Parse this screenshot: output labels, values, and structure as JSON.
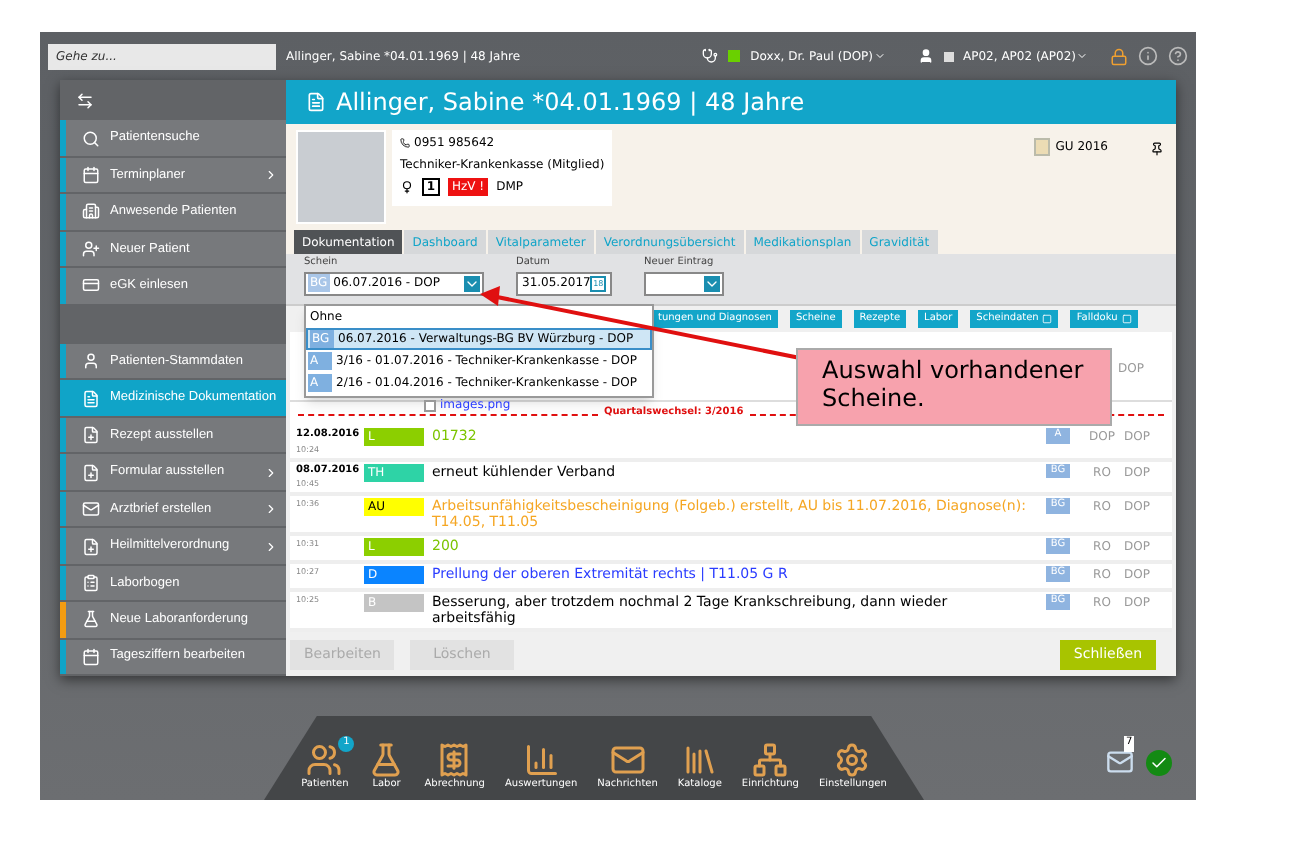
{
  "top_bar": {
    "goto_placeholder": "Gehe zu...",
    "patient": "Allinger, Sabine *04.01.1969 | 48 Jahre",
    "doctor": "Doxx, Dr. Paul (DOP)",
    "workstation": "AP02, AP02 (AP02)"
  },
  "sidebar": {
    "groups": [
      [
        {
          "label": "Patientensuche",
          "submenu": false,
          "selected": false,
          "color": "#10a4c8"
        },
        {
          "label": "Terminplaner",
          "submenu": true,
          "selected": false,
          "color": "#10a4c8"
        },
        {
          "label": "Anwesende Patienten",
          "submenu": false,
          "selected": false,
          "color": "#10a4c8"
        },
        {
          "label": "Neuer Patient",
          "submenu": false,
          "selected": false,
          "color": "#10a4c8"
        },
        {
          "label": "eGK einlesen",
          "submenu": false,
          "selected": false,
          "color": "#10a4c8"
        }
      ],
      [
        {
          "label": "Patienten-Stammdaten",
          "submenu": false,
          "selected": false,
          "color": "#10a4c8"
        },
        {
          "label": "Medizinische Dokumentation",
          "submenu": false,
          "selected": true,
          "color": "#10a4c8"
        },
        {
          "label": "Rezept ausstellen",
          "submenu": false,
          "selected": false,
          "color": "#10a4c8"
        },
        {
          "label": "Formular ausstellen",
          "submenu": true,
          "selected": false,
          "color": "#10a4c8"
        },
        {
          "label": "Arztbrief erstellen",
          "submenu": true,
          "selected": false,
          "color": "#10a4c8"
        },
        {
          "label": "Heilmittelverordnung",
          "submenu": true,
          "selected": false,
          "color": "#10a4c8"
        },
        {
          "label": "Laborbogen",
          "submenu": false,
          "selected": false,
          "color": "#10a4c8"
        },
        {
          "label": "Neue Laboranforderung",
          "submenu": false,
          "selected": false,
          "color": "#f39c12"
        },
        {
          "label": "Tagesziffern bearbeiten",
          "submenu": false,
          "selected": false,
          "color": "#10a4c8"
        }
      ]
    ]
  },
  "header": {
    "title": "Allinger, Sabine *04.01.1969 | 48 Jahre"
  },
  "patient_card": {
    "phone": "0951 985642",
    "insurance": "Techniker-Krankenkasse (Mitglied)",
    "calendar_day": "1",
    "hzv": "HzV !",
    "dmp": "DMP",
    "gu": "GU 2016"
  },
  "tabs": [
    {
      "label": "Dokumentation",
      "selected": true
    },
    {
      "label": "Dashboard",
      "selected": false
    },
    {
      "label": "Vitalparameter",
      "selected": false
    },
    {
      "label": "Verordnungsübersicht",
      "selected": false
    },
    {
      "label": "Medikationsplan",
      "selected": false
    },
    {
      "label": "Gravidität",
      "selected": false
    }
  ],
  "form": {
    "schein_label": "Schein",
    "schein_badge": "BG",
    "schein_value": "06.07.2016 - DOP",
    "datum_label": "Datum",
    "datum_value": "31.05.2017",
    "calendar_day": "18",
    "entry_label": "Neuer Eintrag"
  },
  "schein_dropdown": {
    "none_option": "Ohne",
    "options": [
      {
        "badge": "BG",
        "label": "06.07.2016 - Verwaltungs-BG BV Würzburg - DOP",
        "selected": true
      },
      {
        "badge": "A",
        "label": "3/16 - 01.07.2016 - Techniker-Krankenkasse - DOP",
        "selected": false
      },
      {
        "badge": "A",
        "label": "2/16 - 01.04.2016 - Techniker-Krankenkasse - DOP",
        "selected": false
      }
    ]
  },
  "filters": [
    {
      "label": "tungen und Diagnosen",
      "icon": false
    },
    {
      "label": "Scheine",
      "icon": false
    },
    {
      "label": "Rezepte",
      "icon": false
    },
    {
      "label": "Labor",
      "icon": false
    },
    {
      "label": "Scheindaten",
      "icon": true
    },
    {
      "label": "Falldoku",
      "icon": true
    }
  ],
  "attachment": {
    "file": "images.png",
    "checked": false,
    "doctor": "DOP"
  },
  "quarter_change": "Quartalswechsel: 3/2016",
  "entries": [
    {
      "date": "12.08.2016",
      "time": "10:24",
      "tag": "L",
      "kind": "lab",
      "color": "#8ccf00",
      "text": "01732",
      "schein": "A",
      "user": "DOP",
      "doctor": "DOP"
    },
    {
      "date": "08.07.2016",
      "time": "10:45",
      "tag": "TH",
      "kind": "therapy",
      "color": "#2ed3a6",
      "text": "erneut kühlender Verband",
      "schein": "BG",
      "user": "RO",
      "doctor": "DOP"
    },
    {
      "time": "10:36",
      "tag": "AU",
      "kind": "au",
      "color": "#ffff00",
      "text": "Arbeitsunfähigkeitsbescheinigung (Folgeb.) erstellt, AU bis 11.07.2016, Diagnose(n): T14.05, T11.05",
      "schein": "BG",
      "user": "RO",
      "doctor": "DOP"
    },
    {
      "time": "10:31",
      "tag": "L",
      "kind": "lab",
      "color": "#8ccf00",
      "text": "200",
      "schein": "BG",
      "user": "RO",
      "doctor": "DOP"
    },
    {
      "time": "10:27",
      "tag": "D",
      "kind": "diagnosis",
      "color": "#0a84ff",
      "text": "Prellung der oberen Extremität rechts |  T11.05 G R",
      "schein": "BG",
      "user": "RO",
      "doctor": "DOP"
    },
    {
      "time": "10:25",
      "tag": "B",
      "kind": "finding",
      "color": "#c4c4c4",
      "text": "Besserung, aber trotzdem nochmal 2 Tage Krankschreibung, dann wieder arbeitsfähig",
      "schein": "BG",
      "user": "RO",
      "doctor": "DOP"
    }
  ],
  "buttons": [
    {
      "label": "Bearbeiten",
      "kind": "secondary",
      "disabled": true
    },
    {
      "label": "Löschen",
      "kind": "secondary",
      "disabled": true
    },
    {
      "label": "Schließen",
      "kind": "primary",
      "disabled": false
    }
  ],
  "callout": {
    "text": "Auswahl vorhandener Scheine."
  },
  "dock": [
    {
      "label": "Patienten",
      "badge": "1"
    },
    {
      "label": "Labor"
    },
    {
      "label": "Abrechnung"
    },
    {
      "label": "Auswertungen"
    },
    {
      "label": "Nachrichten"
    },
    {
      "label": "Kataloge"
    },
    {
      "label": "Einrichtung"
    },
    {
      "label": "Einstellungen"
    }
  ],
  "messages": {
    "count": "7"
  }
}
